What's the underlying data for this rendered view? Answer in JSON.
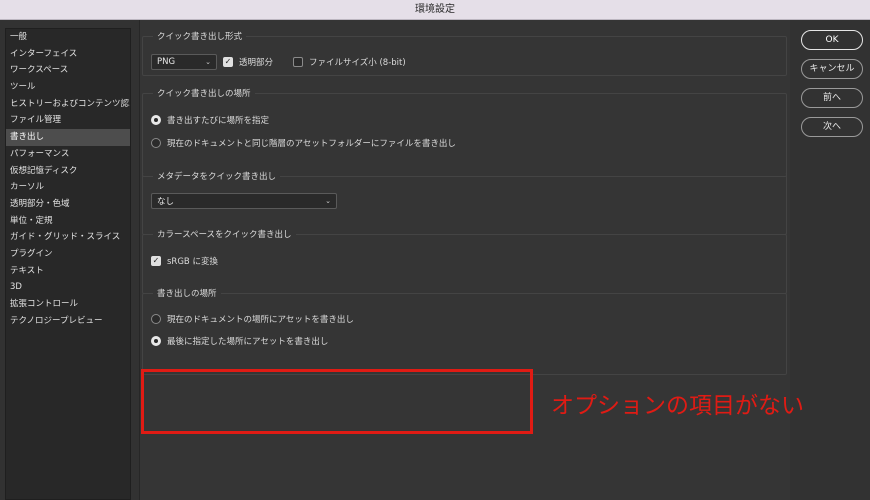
{
  "window": {
    "title": "環境設定"
  },
  "sidebar": {
    "items": [
      {
        "label": "一般"
      },
      {
        "label": "インターフェイス"
      },
      {
        "label": "ワークスペース"
      },
      {
        "label": "ツール"
      },
      {
        "label": "ヒストリーおよびコンテンツ認..."
      },
      {
        "label": "ファイル管理"
      },
      {
        "label": "書き出し",
        "active": true
      },
      {
        "label": "パフォーマンス"
      },
      {
        "label": "仮想記憶ディスク"
      },
      {
        "label": "カーソル"
      },
      {
        "label": "透明部分・色域"
      },
      {
        "label": "単位・定規"
      },
      {
        "label": "ガイド・グリッド・スライス"
      },
      {
        "label": "プラグイン"
      },
      {
        "label": "テキスト"
      },
      {
        "label": "3D"
      },
      {
        "label": "拡張コントロール"
      },
      {
        "label": "テクノロジープレビュー"
      }
    ]
  },
  "quick_export_format": {
    "title": "クイック書き出し形式",
    "format_value": "PNG",
    "transparency_label": "透明部分",
    "transparency_checked": true,
    "small_file_label": "ファイルサイズ小 (8-bit)",
    "small_file_checked": false
  },
  "quick_export_location": {
    "title": "クイック書き出しの場所",
    "option1": "書き出すたびに場所を指定",
    "option2": "現在のドキュメントと同じ階層のアセットフォルダーにファイルを書き出し",
    "selected": 1
  },
  "metadata": {
    "title": "メタデータをクイック書き出し",
    "value": "なし"
  },
  "colorspace": {
    "title": "カラースペースをクイック書き出し",
    "srgb_label": "sRGB に変換",
    "srgb_checked": true
  },
  "export_location": {
    "title": "書き出しの場所",
    "option1": "現在のドキュメントの場所にアセットを書き出し",
    "option2": "最後に指定した場所にアセットを書き出し",
    "selected": 2
  },
  "buttons": {
    "ok": "OK",
    "cancel": "キャンセル",
    "prev": "前へ",
    "next": "次へ"
  },
  "annotation": {
    "text": "オプションの項目がない",
    "color": "#e01b14"
  }
}
